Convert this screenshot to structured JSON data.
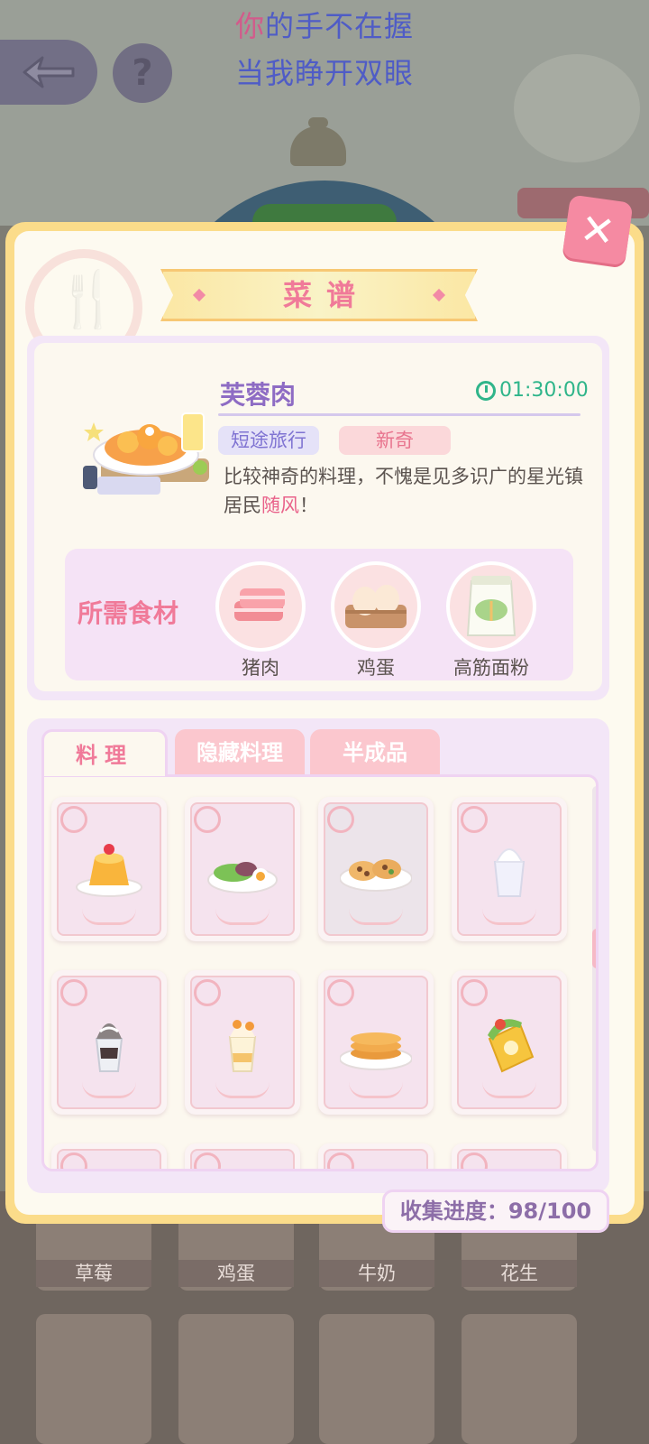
{
  "lyrics": {
    "line1_first": "你",
    "line1_rest": "的手不在握",
    "line2": "当我睁开双眼"
  },
  "dialog": {
    "title": "菜谱",
    "close_label": "✕"
  },
  "recipe": {
    "name": "芙蓉肉",
    "time": "01:30:00",
    "tags": [
      "短途旅行",
      "新奇"
    ],
    "desc_before": "比较神奇的料理，不愧是见多识广的星光镇居民",
    "desc_highlight": "随风",
    "desc_after": "！",
    "ingredients_title": "所需食材",
    "ingredients": [
      {
        "name": "猪肉",
        "icon": "pork-icon"
      },
      {
        "name": "鸡蛋",
        "icon": "eggs-icon"
      },
      {
        "name": "高筋面粉",
        "icon": "flour-icon"
      }
    ]
  },
  "tabs": [
    {
      "label": "料理",
      "active": true
    },
    {
      "label": "隐藏料理",
      "active": false
    },
    {
      "label": "半成品",
      "active": false
    }
  ],
  "cards": [
    {
      "icon": "pudding-icon"
    },
    {
      "icon": "salad-icon"
    },
    {
      "icon": "cookies-icon"
    },
    {
      "icon": "milkshake-icon"
    },
    {
      "icon": "chocolate-sundae-icon"
    },
    {
      "icon": "parfait-icon"
    },
    {
      "icon": "pancakes-icon"
    },
    {
      "icon": "wrap-icon"
    }
  ],
  "scroll_position": 0.4,
  "progress": {
    "label": "收集进度：",
    "collected": "98",
    "total": "100",
    "text": "收集进度：98/100"
  },
  "background_items": [
    "草莓",
    "鸡蛋",
    "牛奶",
    "花生"
  ],
  "colors": {
    "accent_pink": "#f07a99",
    "purple": "#8e6cc4",
    "green": "#2fb58a",
    "dialog_frame": "#fbdc8a"
  }
}
